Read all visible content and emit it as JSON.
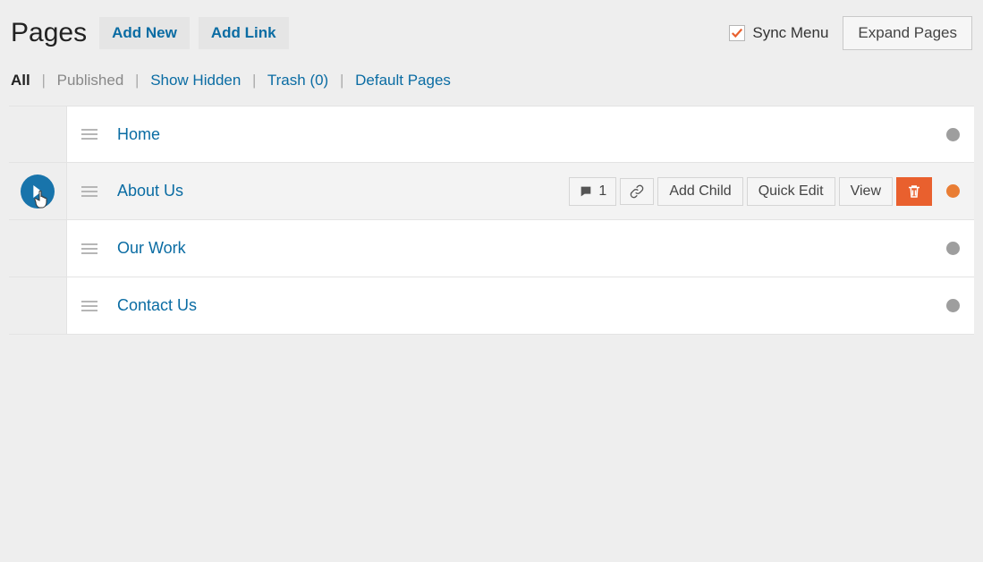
{
  "header": {
    "title": "Pages",
    "add_new_label": "Add New",
    "add_link_label": "Add Link",
    "sync_menu_label": "Sync Menu",
    "sync_menu_checked": true,
    "expand_pages_label": "Expand Pages"
  },
  "filters": {
    "all": "All",
    "published": "Published",
    "show_hidden": "Show Hidden",
    "trash": "Trash (0)",
    "default_pages": "Default Pages",
    "sep": "|"
  },
  "row_actions": {
    "comments_count": "1",
    "add_child": "Add Child",
    "quick_edit": "Quick Edit",
    "view": "View"
  },
  "pages": [
    {
      "title": "Home"
    },
    {
      "title": "About Us"
    },
    {
      "title": "Our Work"
    },
    {
      "title": "Contact Us"
    }
  ]
}
